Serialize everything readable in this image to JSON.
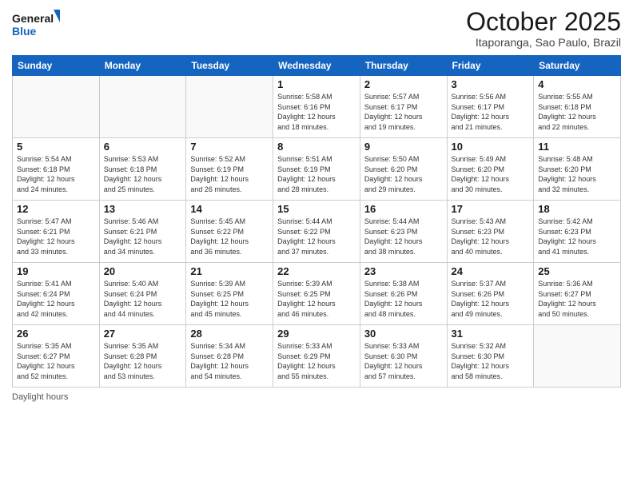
{
  "header": {
    "logo_line1": "General",
    "logo_line2": "Blue",
    "month_title": "October 2025",
    "location": "Itaporanga, Sao Paulo, Brazil"
  },
  "weekdays": [
    "Sunday",
    "Monday",
    "Tuesday",
    "Wednesday",
    "Thursday",
    "Friday",
    "Saturday"
  ],
  "weeks": [
    [
      {
        "day": "",
        "info": ""
      },
      {
        "day": "",
        "info": ""
      },
      {
        "day": "",
        "info": ""
      },
      {
        "day": "1",
        "info": "Sunrise: 5:58 AM\nSunset: 6:16 PM\nDaylight: 12 hours\nand 18 minutes."
      },
      {
        "day": "2",
        "info": "Sunrise: 5:57 AM\nSunset: 6:17 PM\nDaylight: 12 hours\nand 19 minutes."
      },
      {
        "day": "3",
        "info": "Sunrise: 5:56 AM\nSunset: 6:17 PM\nDaylight: 12 hours\nand 21 minutes."
      },
      {
        "day": "4",
        "info": "Sunrise: 5:55 AM\nSunset: 6:18 PM\nDaylight: 12 hours\nand 22 minutes."
      }
    ],
    [
      {
        "day": "5",
        "info": "Sunrise: 5:54 AM\nSunset: 6:18 PM\nDaylight: 12 hours\nand 24 minutes."
      },
      {
        "day": "6",
        "info": "Sunrise: 5:53 AM\nSunset: 6:18 PM\nDaylight: 12 hours\nand 25 minutes."
      },
      {
        "day": "7",
        "info": "Sunrise: 5:52 AM\nSunset: 6:19 PM\nDaylight: 12 hours\nand 26 minutes."
      },
      {
        "day": "8",
        "info": "Sunrise: 5:51 AM\nSunset: 6:19 PM\nDaylight: 12 hours\nand 28 minutes."
      },
      {
        "day": "9",
        "info": "Sunrise: 5:50 AM\nSunset: 6:20 PM\nDaylight: 12 hours\nand 29 minutes."
      },
      {
        "day": "10",
        "info": "Sunrise: 5:49 AM\nSunset: 6:20 PM\nDaylight: 12 hours\nand 30 minutes."
      },
      {
        "day": "11",
        "info": "Sunrise: 5:48 AM\nSunset: 6:20 PM\nDaylight: 12 hours\nand 32 minutes."
      }
    ],
    [
      {
        "day": "12",
        "info": "Sunrise: 5:47 AM\nSunset: 6:21 PM\nDaylight: 12 hours\nand 33 minutes."
      },
      {
        "day": "13",
        "info": "Sunrise: 5:46 AM\nSunset: 6:21 PM\nDaylight: 12 hours\nand 34 minutes."
      },
      {
        "day": "14",
        "info": "Sunrise: 5:45 AM\nSunset: 6:22 PM\nDaylight: 12 hours\nand 36 minutes."
      },
      {
        "day": "15",
        "info": "Sunrise: 5:44 AM\nSunset: 6:22 PM\nDaylight: 12 hours\nand 37 minutes."
      },
      {
        "day": "16",
        "info": "Sunrise: 5:44 AM\nSunset: 6:23 PM\nDaylight: 12 hours\nand 38 minutes."
      },
      {
        "day": "17",
        "info": "Sunrise: 5:43 AM\nSunset: 6:23 PM\nDaylight: 12 hours\nand 40 minutes."
      },
      {
        "day": "18",
        "info": "Sunrise: 5:42 AM\nSunset: 6:23 PM\nDaylight: 12 hours\nand 41 minutes."
      }
    ],
    [
      {
        "day": "19",
        "info": "Sunrise: 5:41 AM\nSunset: 6:24 PM\nDaylight: 12 hours\nand 42 minutes."
      },
      {
        "day": "20",
        "info": "Sunrise: 5:40 AM\nSunset: 6:24 PM\nDaylight: 12 hours\nand 44 minutes."
      },
      {
        "day": "21",
        "info": "Sunrise: 5:39 AM\nSunset: 6:25 PM\nDaylight: 12 hours\nand 45 minutes."
      },
      {
        "day": "22",
        "info": "Sunrise: 5:39 AM\nSunset: 6:25 PM\nDaylight: 12 hours\nand 46 minutes."
      },
      {
        "day": "23",
        "info": "Sunrise: 5:38 AM\nSunset: 6:26 PM\nDaylight: 12 hours\nand 48 minutes."
      },
      {
        "day": "24",
        "info": "Sunrise: 5:37 AM\nSunset: 6:26 PM\nDaylight: 12 hours\nand 49 minutes."
      },
      {
        "day": "25",
        "info": "Sunrise: 5:36 AM\nSunset: 6:27 PM\nDaylight: 12 hours\nand 50 minutes."
      }
    ],
    [
      {
        "day": "26",
        "info": "Sunrise: 5:35 AM\nSunset: 6:27 PM\nDaylight: 12 hours\nand 52 minutes."
      },
      {
        "day": "27",
        "info": "Sunrise: 5:35 AM\nSunset: 6:28 PM\nDaylight: 12 hours\nand 53 minutes."
      },
      {
        "day": "28",
        "info": "Sunrise: 5:34 AM\nSunset: 6:28 PM\nDaylight: 12 hours\nand 54 minutes."
      },
      {
        "day": "29",
        "info": "Sunrise: 5:33 AM\nSunset: 6:29 PM\nDaylight: 12 hours\nand 55 minutes."
      },
      {
        "day": "30",
        "info": "Sunrise: 5:33 AM\nSunset: 6:30 PM\nDaylight: 12 hours\nand 57 minutes."
      },
      {
        "day": "31",
        "info": "Sunrise: 5:32 AM\nSunset: 6:30 PM\nDaylight: 12 hours\nand 58 minutes."
      },
      {
        "day": "",
        "info": ""
      }
    ]
  ],
  "footer": {
    "daylight_label": "Daylight hours"
  }
}
